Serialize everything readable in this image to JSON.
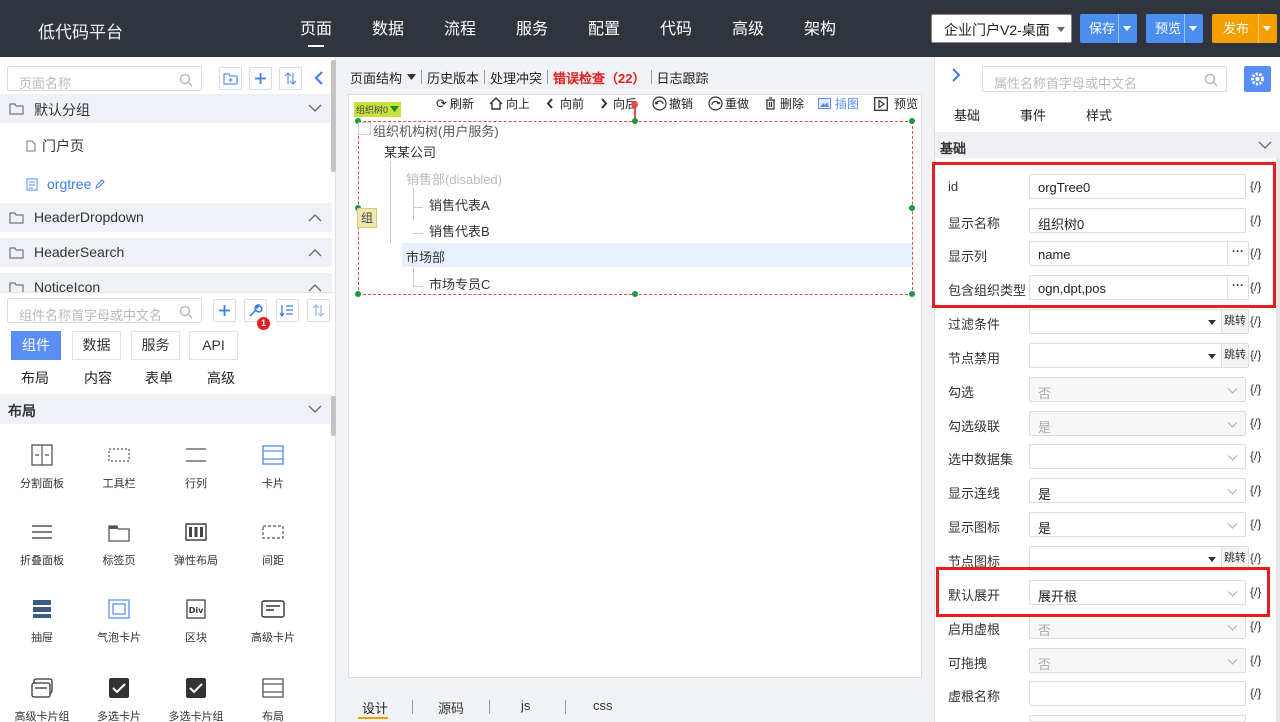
{
  "app": {
    "brand": "低代码平台",
    "nav": [
      "页面",
      "数据",
      "流程",
      "服务",
      "配置",
      "代码",
      "高级",
      "架构"
    ],
    "project": "企业门户V2-桌面",
    "buttons": {
      "save": "保存",
      "preview": "预览",
      "publish": "发布"
    },
    "colors": {
      "topbar": "#30353d",
      "save": "#4a8ef0",
      "preview": "#4a8ef0",
      "publish": "#f5a000",
      "accent": "#5a8ef5",
      "error": "#e41f1f"
    }
  },
  "left": {
    "page_search_placeholder": "页面名称",
    "default_group": "默认分组",
    "pages": [
      "门户页",
      "orgtree"
    ],
    "groups": [
      "HeaderDropdown",
      "HeaderSearch",
      "NoticeIcon"
    ],
    "comp_search_placeholder": "组件名称首字母或中文名",
    "badge": "1",
    "tabs": [
      "组件",
      "数据",
      "服务",
      "API"
    ],
    "subtabs": [
      "布局",
      "内容",
      "表单",
      "高级"
    ],
    "section": "布局",
    "components": [
      "分割面板",
      "工具栏",
      "行列",
      "卡片",
      "折叠面板",
      "标签页",
      "弹性布局",
      "间距",
      "抽屉",
      "气泡卡片",
      "区块",
      "高级卡片",
      "高级卡片组",
      "多选卡片",
      "多选卡片组",
      "布局"
    ]
  },
  "center": {
    "toolbar": {
      "structure": "页面结构",
      "history": "历史版本",
      "conflict": "处理冲突",
      "errors": "错误检查（22）",
      "log": "日志跟踪"
    },
    "actions": [
      "刷新",
      "向上",
      "向前",
      "向后",
      "撤销",
      "重做",
      "删除",
      "插图",
      "预览"
    ],
    "tag": "组织树0",
    "tree": {
      "root": "组织机构树(用户服务)",
      "company": "某某公司",
      "sales": "销售部(disabled)",
      "rep_a": "销售代表A",
      "rep_b": "销售代表B",
      "market": "市场部",
      "market_c": "市场专员C"
    },
    "side_tag": "组",
    "bottom_tabs": [
      "设计",
      "源码",
      "js",
      "css"
    ]
  },
  "right": {
    "search_placeholder": "属性名称首字母或中文名",
    "tabs": [
      "基础",
      "事件",
      "样式"
    ],
    "section": "基础",
    "expr": "{/}",
    "jump": "跳转",
    "more": "···",
    "props": [
      {
        "label": "id",
        "value": "orgTree0"
      },
      {
        "label": "显示名称",
        "value": "组织树0"
      },
      {
        "label": "显示列",
        "value": "name"
      },
      {
        "label": "包含组织类型",
        "value": "ogn,dpt,pos"
      },
      {
        "label": "过滤条件",
        "value": ""
      },
      {
        "label": "节点禁用",
        "value": ""
      },
      {
        "label": "勾选",
        "value": "否"
      },
      {
        "label": "勾选级联",
        "value": "是"
      },
      {
        "label": "选中数据集",
        "value": ""
      },
      {
        "label": "显示连线",
        "value": "是"
      },
      {
        "label": "显示图标",
        "value": "是"
      },
      {
        "label": "节点图标",
        "value": ""
      },
      {
        "label": "默认展开",
        "value": "展开根"
      },
      {
        "label": "启用虚根",
        "value": "否"
      },
      {
        "label": "可拖拽",
        "value": "否"
      },
      {
        "label": "虚根名称",
        "value": ""
      }
    ]
  }
}
